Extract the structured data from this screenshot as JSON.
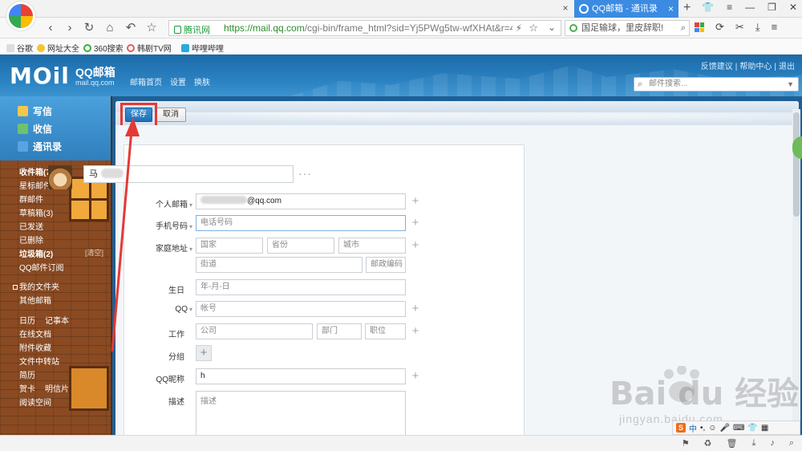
{
  "browser": {
    "active_tab_title": "QQ邮箱 - 通讯录",
    "tab_close": "×",
    "new_tab": "+",
    "security_label": "腾讯网",
    "url_host": "https://mail.qq.com",
    "url_path": "/cgi-bin/frame_html?sid=Yj5PWg5tw-wfXHAt&r=4c",
    "search_text": "国足输球，里皮辞职!",
    "bookmarks": [
      "谷歌",
      "网址大全",
      "360搜索",
      "韩剧TV网",
      "哔哩哔哩"
    ],
    "icons": {
      "back": "back-icon",
      "forward": "forward-icon",
      "refresh": "refresh-icon",
      "home": "home-icon",
      "undo": "undo-icon",
      "star": "star-icon"
    }
  },
  "mail_header": {
    "brand": "MOil",
    "brand_cn": "QQ邮箱",
    "brand_url": "mail.qq.com",
    "nav": [
      "邮箱首页",
      "设置",
      "换肤"
    ],
    "top_links": [
      "反馈建议",
      "帮助中心",
      "退出"
    ],
    "search_placeholder": "邮件搜索..."
  },
  "sidebar": {
    "compose": "写信",
    "inbox": "收信",
    "contacts": "通讯录",
    "folders": [
      {
        "label": "收件箱(78)",
        "bold": true
      },
      {
        "label": "星标邮件",
        "star": "★"
      },
      {
        "label": "群邮件"
      },
      {
        "label": "草稿箱(3)"
      },
      {
        "label": "已发送"
      },
      {
        "label": "已删除"
      },
      {
        "label": "垃圾箱(2)",
        "bold": true
      },
      {
        "label": "QQ邮件订阅"
      }
    ],
    "clear_label": "[清空]",
    "my_folders": "我的文件夹",
    "other_mailbox": "其他邮箱",
    "tools_row": [
      "日历",
      "记事本"
    ],
    "tools": [
      "在线文档",
      "附件收藏",
      "文件中转站",
      "简历",
      "贺卡",
      "明信片",
      "阅读空间"
    ]
  },
  "toolbar": {
    "save_label": "保存",
    "cancel_label": "取消"
  },
  "form": {
    "name_value": "马",
    "more": "···",
    "fields": {
      "email_label": "个人邮箱",
      "email_value": "@qq.com",
      "phone_label": "手机号码",
      "phone_placeholder": "电话号码",
      "address_label": "家庭地址",
      "country_placeholder": "国家",
      "province_placeholder": "省份",
      "city_placeholder": "城市",
      "street_placeholder": "街道",
      "zip_placeholder": "邮政编码",
      "birthday_label": "生日",
      "birthday_placeholder": "年-月-日",
      "qq_label": "QQ",
      "qq_placeholder": "帐号",
      "work_label": "工作",
      "company_placeholder": "公司",
      "department_placeholder": "部门",
      "position_placeholder": "职位",
      "group_label": "分组",
      "nickname_label": "QQ昵称",
      "nickname_value": "h",
      "desc_label": "描述",
      "desc_placeholder": "描述"
    },
    "dropdown_marker": "▾",
    "plus": "+"
  },
  "watermark": {
    "brand": "Bai du 经验",
    "url": "jingyan.baidu.com"
  },
  "ime": {
    "logo": "S",
    "mode": "中"
  }
}
